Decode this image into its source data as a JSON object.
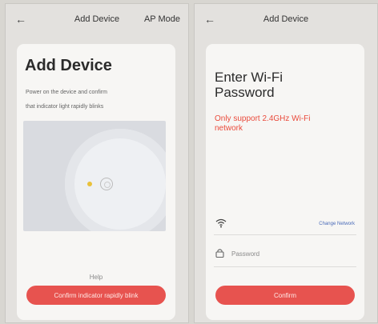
{
  "left": {
    "header": {
      "back_icon": "back-arrow-icon",
      "title": "Add Device",
      "right": "AP Mode"
    },
    "heading": "Add Device",
    "description_line1": "Power on the device and confirm",
    "description_line2": "that indicator light rapidly blinks",
    "help_label": "Help",
    "confirm_button": "Confirm indicator rapidly blink"
  },
  "right": {
    "header": {
      "back_icon": "back-arrow-icon",
      "title": "Add Device"
    },
    "heading_line1": "Enter Wi-Fi",
    "heading_line2": "Password",
    "warning_line1": "Only support 2.4GHz Wi-Fi",
    "warning_line2": "network",
    "wifi_icon": "wifi-icon",
    "change_network_link": "Change Network",
    "lock_icon": "lock-icon",
    "password_placeholder": "Password",
    "confirm_button": "Confirm"
  },
  "colors": {
    "accent": "#e7534f",
    "warning": "#ea4b3c",
    "link": "#4a6bb8"
  }
}
